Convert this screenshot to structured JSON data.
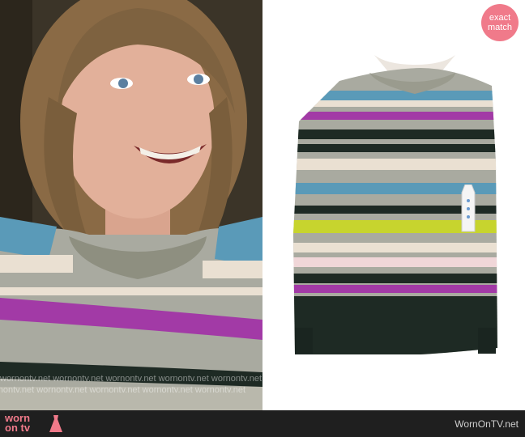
{
  "badge": {
    "line1": "exact",
    "line2": "match"
  },
  "footer": {
    "logo_line1": "worn",
    "logo_line2": "on tv",
    "site_name": "WornOnTV.net"
  },
  "watermark": {
    "text": "wornontv.net  wornontv.net  wornontv.net  wornontv.net  wornontv.net"
  },
  "colors": {
    "sweater_grey": "#a9aaa0",
    "stripe_blue": "#5a9ab8",
    "stripe_magenta": "#a23aa6",
    "stripe_cream": "#eae0d2",
    "stripe_darkgreen": "#1e2a24",
    "stripe_lime": "#c7d42e",
    "stripe_pink": "#f0d6d8",
    "badge_pink": "#f07a8a",
    "footer_bg": "#1f1f1f"
  }
}
